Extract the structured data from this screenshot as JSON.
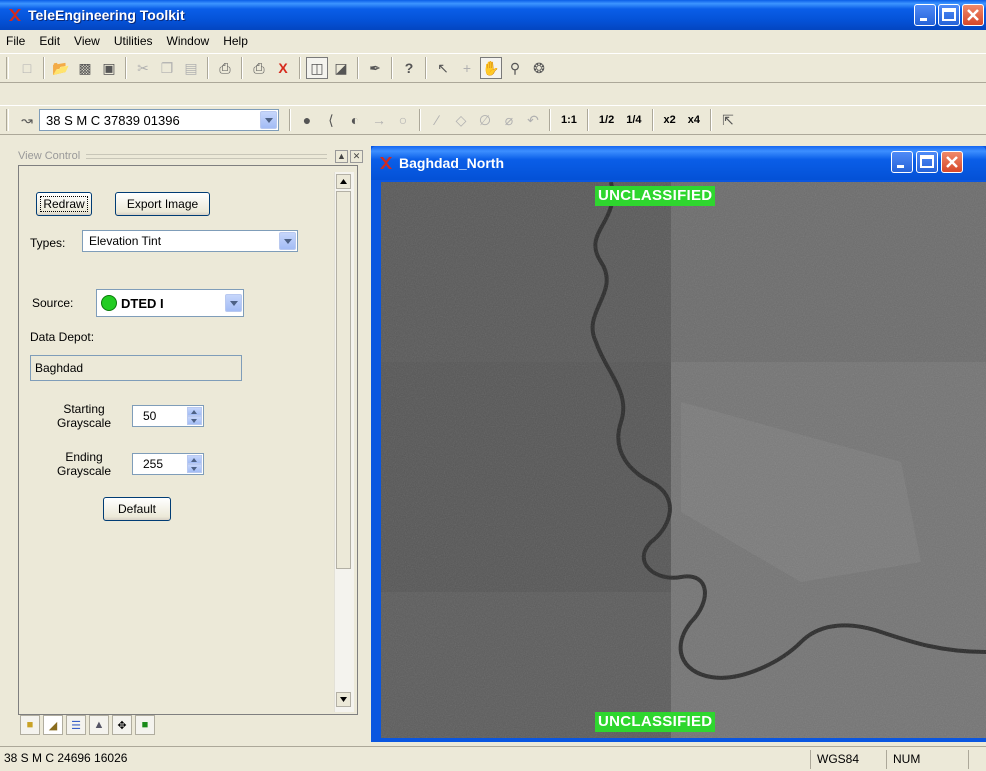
{
  "app": {
    "title": "TeleEngineering Toolkit",
    "icon": "tet-logo-icon",
    "brand_color": "#d62a1c"
  },
  "menu": [
    "File",
    "Edit",
    "View",
    "Utilities",
    "Window",
    "Help"
  ],
  "coord_toolbar": {
    "coordinate": "38 S M C 37839 01396",
    "scales": [
      "1:1",
      "1/2",
      "1/4",
      "x2",
      "x4"
    ]
  },
  "view_control": {
    "title": "View Control",
    "redraw_label": "Redraw",
    "export_label": "Export Image",
    "types_label": "Types:",
    "types_value": "Elevation Tint",
    "source_label": "Source:",
    "source_value": "DTED I",
    "source_status_color": "#22cc22",
    "data_depot_label": "Data Depot:",
    "data_depot_value": "Baghdad",
    "start_gray_label_1": "Starting",
    "start_gray_label_2": "Grayscale",
    "start_gray_value": "50",
    "end_gray_label_1": "Ending",
    "end_gray_label_2": "Grayscale",
    "end_gray_value": "255",
    "default_label": "Default"
  },
  "map_window": {
    "title": "Baghdad_North",
    "banner_top": "UNCLASSIFIED",
    "banner_bottom": "UNCLASSIFIED",
    "banner_color": "#2ed62e"
  },
  "status": {
    "coordinate": "38 S M C 24696 16026",
    "datum": "WGS84",
    "num": "NUM"
  }
}
